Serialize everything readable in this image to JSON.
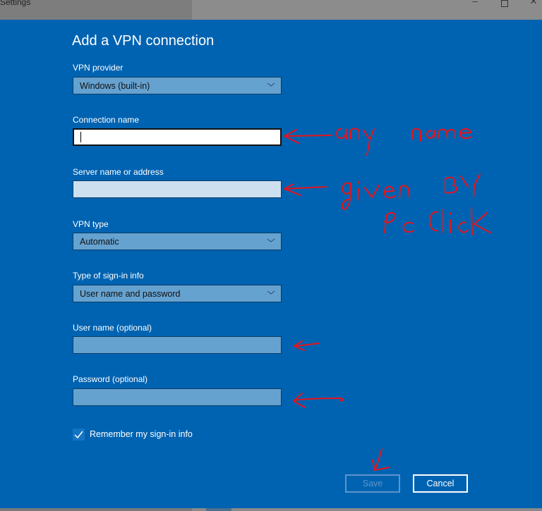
{
  "window": {
    "title": "Settings",
    "controls": {
      "minimize": "–",
      "maximize": "□",
      "close": "✕"
    }
  },
  "dialog": {
    "heading": "Add a VPN connection",
    "fields": {
      "vpn_provider": {
        "label": "VPN provider",
        "value": "Windows (built-in)"
      },
      "connection_name": {
        "label": "Connection name",
        "value": ""
      },
      "server": {
        "label": "Server name or address",
        "value": ""
      },
      "vpn_type": {
        "label": "VPN type",
        "value": "Automatic"
      },
      "signin_type": {
        "label": "Type of sign-in info",
        "value": "User name and password"
      },
      "username": {
        "label": "User name (optional)",
        "value": ""
      },
      "password": {
        "label": "Password (optional)",
        "value": ""
      }
    },
    "remember": {
      "label": "Remember my sign-in info",
      "checked": true
    },
    "buttons": {
      "save": "Save",
      "cancel": "Cancel"
    }
  },
  "annotations": {
    "color": "#e8141c",
    "connection_name_note": "any name",
    "server_note_line1": "given BY",
    "server_note_line2": "Pc Click"
  }
}
